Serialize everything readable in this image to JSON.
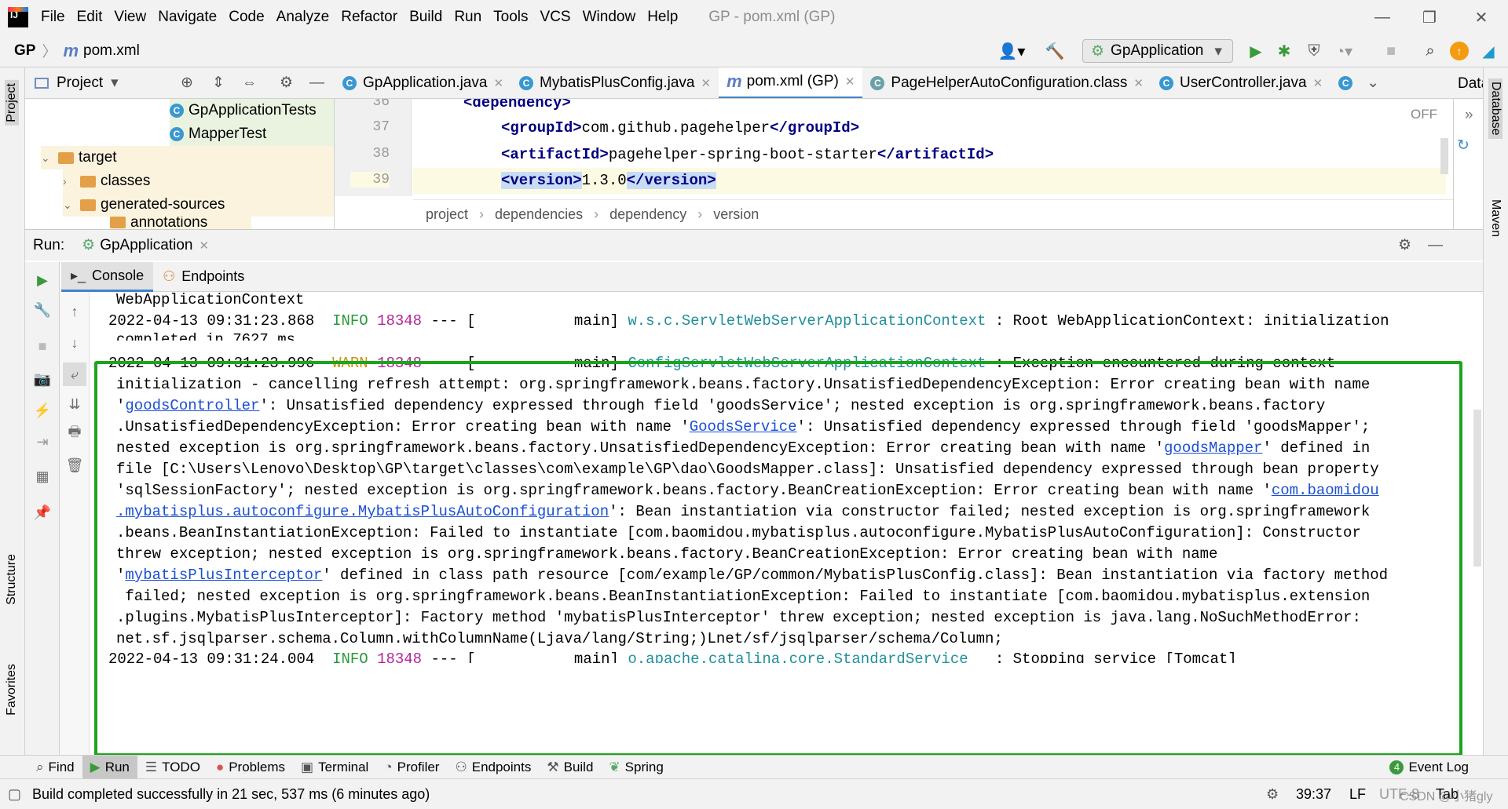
{
  "menubar": {
    "items": [
      "File",
      "Edit",
      "View",
      "Navigate",
      "Code",
      "Analyze",
      "Refactor",
      "Build",
      "Run",
      "Tools",
      "VCS",
      "Window",
      "Help"
    ],
    "title": "GP - pom.xml (GP)"
  },
  "navbar": {
    "project": "GP",
    "file": "pom.xml",
    "run_config": "GpApplication"
  },
  "left_strip": {
    "project_tab": "Project",
    "structure_tab": "Structure",
    "favorites_tab": "Favorites"
  },
  "right_strip": {
    "database_tab": "Database",
    "maven_tab": "Maven"
  },
  "project_panel": {
    "title": "Project",
    "tree": [
      {
        "label": "GpApplicationTests",
        "kind": "class"
      },
      {
        "label": "MapperTest",
        "kind": "class"
      },
      {
        "label": "target",
        "kind": "folder"
      },
      {
        "label": "classes",
        "kind": "folder"
      },
      {
        "label": "generated-sources",
        "kind": "folder"
      },
      {
        "label": "annotations",
        "kind": "folder"
      }
    ]
  },
  "editor_tabs": [
    {
      "label": "GpApplication.java",
      "icon": "class-icon"
    },
    {
      "label": "MybatisPlusConfig.java",
      "icon": "class-icon"
    },
    {
      "label": "pom.xml (GP)",
      "icon": "maven-icon",
      "active": true
    },
    {
      "label": "PageHelperAutoConfiguration.class",
      "icon": "class-icon"
    },
    {
      "label": "UserController.java",
      "icon": "class-icon"
    }
  ],
  "editor": {
    "lines": [
      {
        "num": "36",
        "text": "<dependency>"
      },
      {
        "num": "37",
        "open": "<groupId>",
        "value": "com.github.pagehelper",
        "close": "</groupId>"
      },
      {
        "num": "38",
        "open": "<artifactId>",
        "value": "pagehelper-spring-boot-starter",
        "close": "</artifactId>"
      },
      {
        "num": "39",
        "open": "<version>",
        "value": "1.3.0",
        "close": "</version>"
      }
    ],
    "off_label": "OFF",
    "breadcrumbs": [
      "project",
      "dependencies",
      "dependency",
      "version"
    ]
  },
  "right_panel_label": "Data",
  "run": {
    "label": "Run:",
    "config": "GpApplication",
    "tabs": [
      "Console",
      "Endpoints"
    ]
  },
  "console": {
    "line0": "WebApplicationContext",
    "line1": {
      "ts": "2022-04-13 09:31:23.868",
      "level": "INFO",
      "pid": "18348",
      "sep": "--- [           main]",
      "logger": "w.s.c.ServletWebServerApplicationContext",
      "msg": " : Root WebApplicationContext: initialization"
    },
    "line1b": "completed in 7627 ms",
    "warn": {
      "ts": "2022-04-13 09:31:23.996",
      "level": "WARN",
      "pid": "18348",
      "sep": "--- [           main]",
      "logger": "ConfigServletWebServerApplicationContext",
      "msg": " : Exception encountered during context"
    },
    "w1": "initialization - cancelling refresh attempt: org.springframework.beans.factory.UnsatisfiedDependencyException: Error creating bean with name",
    "w2a": "'",
    "w2link": "goodsController",
    "w2b": "': Unsatisfied dependency expressed through field 'goodsService'; nested exception is org.springframework.beans.factory",
    "w3a": ".UnsatisfiedDependencyException: Error creating bean with name '",
    "w3link": "GoodsService",
    "w3b": "': Unsatisfied dependency expressed through field 'goodsMapper';",
    "w4a": "nested exception is org.springframework.beans.factory.UnsatisfiedDependencyException: Error creating bean with name '",
    "w4link": "goodsMapper",
    "w4b": "' defined in",
    "w5": "file [C:\\Users\\Lenovo\\Desktop\\GP\\target\\classes\\com\\example\\GP\\dao\\GoodsMapper.class]: Unsatisfied dependency expressed through bean property",
    "w6a": "'sqlSessionFactory'; nested exception is org.springframework.beans.factory.BeanCreationException: Error creating bean with name '",
    "w6link": "com.baomidou",
    "w7link": ".mybatisplus.autoconfigure.MybatisPlusAutoConfiguration",
    "w7b": "': Bean instantiation via constructor failed; nested exception is org.springframework",
    "w8": ".beans.BeanInstantiationException: Failed to instantiate [com.baomidou.mybatisplus.autoconfigure.MybatisPlusAutoConfiguration]: Constructor",
    "w9": "threw exception; nested exception is org.springframework.beans.factory.BeanCreationException: Error creating bean with name",
    "w10a": "'",
    "w10link": "mybatisPlusInterceptor",
    "w10b": "' defined in class path resource [com/example/GP/common/MybatisPlusConfig.class]: Bean instantiation via factory method",
    "w11": " failed; nested exception is org.springframework.beans.BeanInstantiationException: Failed to instantiate [com.baomidou.mybatisplus.extension",
    "w12": ".plugins.MybatisPlusInterceptor]: Factory method 'mybatisPlusInterceptor' threw exception; nested exception is java.lang.NoSuchMethodError:",
    "w13": "net.sf.jsqlparser.schema.Column.withColumnName(Ljava/lang/String;)Lnet/sf/jsqlparser/schema/Column;",
    "last": {
      "ts": "2022-04-13 09:31:24.004",
      "level": "INFO",
      "pid": "18348",
      "sep": "--- [           main]",
      "logger": "o.apache.catalina.core.StandardService",
      "msg": "   : Stopping service [Tomcat]"
    }
  },
  "tool_windows": [
    "Find",
    "Run",
    "TODO",
    "Problems",
    "Terminal",
    "Profiler",
    "Endpoints",
    "Build",
    "Spring"
  ],
  "event_log": {
    "count": "4",
    "label": "Event Log"
  },
  "status": {
    "message": "Build completed successfully in 21 sec, 537 ms (6 minutes ago)",
    "position": "39:37",
    "line_sep": "LF",
    "encoding": "UTF-8",
    "indent": "Tab",
    "watermark": "CSDN @小猪gly"
  },
  "colors": {
    "accent": "#4083c9",
    "highlight_box": "#1ba51b",
    "info": "#2a9a3a",
    "warn": "#c8910f"
  }
}
